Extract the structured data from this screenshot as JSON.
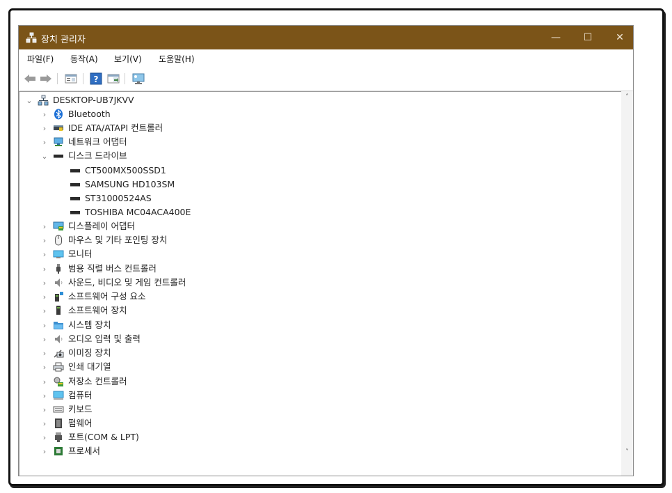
{
  "window": {
    "title": "장치 관리자",
    "minimize": "—",
    "maximize": "☐",
    "close": "✕",
    "title_bar_color": "#7b5418"
  },
  "menu": [
    {
      "label": "파일(F)"
    },
    {
      "label": "동작(A)"
    },
    {
      "label": "보기(V)"
    },
    {
      "label": "도움말(H)"
    }
  ],
  "toolbar": {
    "icons": [
      "back-arrow-icon",
      "forward-arrow-icon",
      "properties-icon",
      "help-icon",
      "view-icon",
      "monitor-scan-icon"
    ]
  },
  "tree": {
    "root": {
      "label": "DESKTOP-UB7JKVV",
      "icon": "computer-network-icon",
      "expanded": true
    },
    "categories": [
      {
        "label": "Bluetooth",
        "icon": "bluetooth-icon"
      },
      {
        "label": "IDE ATA/ATAPI 컨트롤러",
        "icon": "ide-controller-icon"
      },
      {
        "label": "네트워크 어댑터",
        "icon": "network-adapter-icon"
      },
      {
        "label": "디스크 드라이브",
        "icon": "disk-drive-icon",
        "expanded": true,
        "children": [
          {
            "label": "CT500MX500SSD1"
          },
          {
            "label": "SAMSUNG HD103SM"
          },
          {
            "label": "ST31000524AS"
          },
          {
            "label": "TOSHIBA MC04ACA400E"
          }
        ]
      },
      {
        "label": "디스플레이 어댑터",
        "icon": "display-adapter-icon"
      },
      {
        "label": "마우스 및 기타 포인팅 장치",
        "icon": "mouse-icon"
      },
      {
        "label": "모니터",
        "icon": "monitor-icon"
      },
      {
        "label": "범용 직렬 버스 컨트롤러",
        "icon": "usb-icon"
      },
      {
        "label": "사운드, 비디오 및 게임 컨트롤러",
        "icon": "speaker-icon"
      },
      {
        "label": "소프트웨어 구성 요소",
        "icon": "software-component-icon"
      },
      {
        "label": "소프트웨어 장치",
        "icon": "software-device-icon"
      },
      {
        "label": "시스템 장치",
        "icon": "system-folder-icon"
      },
      {
        "label": "오디오 입력 및 출력",
        "icon": "audio-io-icon"
      },
      {
        "label": "이미징 장치",
        "icon": "camera-icon"
      },
      {
        "label": "인쇄 대기열",
        "icon": "printer-icon"
      },
      {
        "label": "저장소 컨트롤러",
        "icon": "storage-controller-icon"
      },
      {
        "label": "컴퓨터",
        "icon": "computer-icon"
      },
      {
        "label": "키보드",
        "icon": "keyboard-icon"
      },
      {
        "label": "펌웨어",
        "icon": "firmware-icon"
      },
      {
        "label": "포트(COM & LPT)",
        "icon": "port-icon"
      },
      {
        "label": "프로세서",
        "icon": "processor-icon"
      }
    ]
  },
  "scrollbar": {
    "up": "˄",
    "down": "˅"
  }
}
